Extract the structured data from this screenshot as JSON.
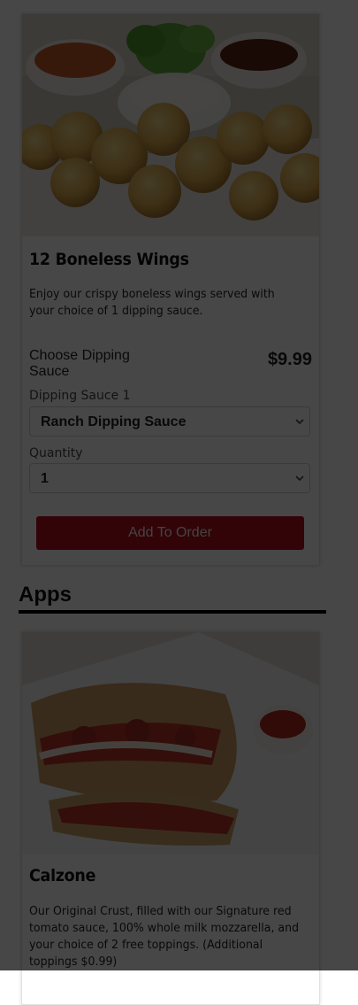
{
  "items": [
    {
      "title": "12 Boneless Wings",
      "description": "Enjoy our crispy boneless wings served with your choice of 1 dipping sauce.",
      "choose_label": "Choose Dipping Sauce",
      "price": "$9.99",
      "sauce_label": "Dipping Sauce 1",
      "sauce_value": "Ranch Dipping Sauce",
      "quantity_label": "Quantity",
      "quantity_value": "1",
      "button_label": "Add To Order"
    },
    {
      "title": "Calzone",
      "description": "Our Original Crust, filled with our Signature red tomato sauce, 100% whole milk mozzarella, and your choice of 2 free toppings. (Additional toppings $0.99)"
    }
  ],
  "section": {
    "heading": "Apps"
  },
  "colors": {
    "button": "#b50f1c",
    "overlay": "rgba(0,0,0,0.72)"
  },
  "icons": {
    "select_chevron": "chevron-down-icon"
  }
}
